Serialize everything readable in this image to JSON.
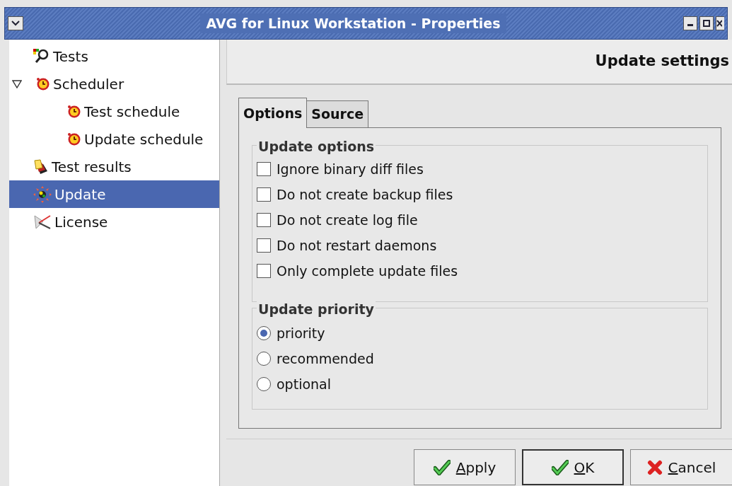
{
  "window": {
    "title": "AVG for Linux Workstation - Properties"
  },
  "sidebar": {
    "items": [
      {
        "label": "Tests",
        "selected": false
      },
      {
        "label": "Scheduler",
        "selected": false,
        "expanded": true,
        "children": [
          {
            "label": "Test schedule",
            "selected": false
          },
          {
            "label": "Update schedule",
            "selected": false
          }
        ]
      },
      {
        "label": "Test results",
        "selected": false
      },
      {
        "label": "Update",
        "selected": true
      },
      {
        "label": "License",
        "selected": false
      }
    ]
  },
  "header": {
    "title": "Update settings"
  },
  "tabs": [
    {
      "label": "Options",
      "selected": true
    },
    {
      "label": "Source",
      "selected": false
    }
  ],
  "update_options": {
    "title": "Update options",
    "items": [
      {
        "label": "Ignore binary diff files",
        "checked": false
      },
      {
        "label": "Do not create backup files",
        "checked": false
      },
      {
        "label": "Do not create log file",
        "checked": false
      },
      {
        "label": "Do not restart daemons",
        "checked": false
      },
      {
        "label": "Only complete update files",
        "checked": false
      }
    ]
  },
  "update_priority": {
    "title": "Update priority",
    "items": [
      {
        "label": "priority",
        "selected": true
      },
      {
        "label": "recommended",
        "selected": false
      },
      {
        "label": "optional",
        "selected": false
      }
    ]
  },
  "buttons": [
    {
      "mnemonic": "A",
      "rest": "pply",
      "kind": "ok",
      "default": false
    },
    {
      "mnemonic": "O",
      "rest": "K",
      "kind": "ok",
      "default": true
    },
    {
      "mnemonic": "C",
      "rest": "ancel",
      "kind": "cancel",
      "default": false
    }
  ]
}
